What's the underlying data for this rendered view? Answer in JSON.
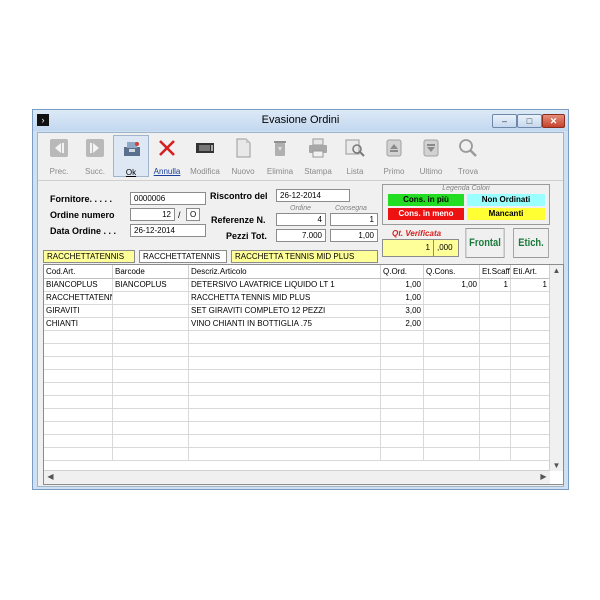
{
  "window": {
    "title": "Evasione Ordini",
    "minimize_glyph": "–",
    "maximize_glyph": "□",
    "close_glyph": "✕"
  },
  "toolbar": {
    "buttons": [
      {
        "label": "Prec.",
        "icon": "first-record-icon",
        "enabled": false
      },
      {
        "label": "Succ.",
        "icon": "next-record-icon",
        "enabled": false
      },
      {
        "label": "Ok",
        "icon": "ok-cash-register-icon",
        "enabled": true
      },
      {
        "label": "Annulla",
        "icon": "cancel-x-icon",
        "enabled": true
      },
      {
        "label": "Modifica",
        "icon": "edit-film-icon",
        "enabled": false
      },
      {
        "label": "Nuovo",
        "icon": "new-document-icon",
        "enabled": false
      },
      {
        "label": "Elimina",
        "icon": "delete-recycle-icon",
        "enabled": false
      },
      {
        "label": "Stampa",
        "icon": "printer-icon",
        "enabled": false
      },
      {
        "label": "Lista",
        "icon": "list-search-icon",
        "enabled": false
      },
      {
        "label": "Primo",
        "icon": "first-icon",
        "enabled": false
      },
      {
        "label": "Ultimo",
        "icon": "last-icon",
        "enabled": false
      },
      {
        "label": "Trova",
        "icon": "magnifier-icon",
        "enabled": false
      }
    ]
  },
  "form": {
    "fornitore_label": "Fornitore. . . . .",
    "fornitore_value": "0000006",
    "ordine_label": "Ordine numero",
    "ordine_value": "12",
    "ordine_sep": "/",
    "ordine_suffix": "O",
    "data_label": "Data Ordine . . .",
    "data_value": "26-12-2014",
    "riscontro_label": "Riscontro del",
    "riscontro_value": "26-12-2014",
    "ordine_col_label": "Ordine",
    "consegna_col_label": "Consegna",
    "referenze_label": "Referenze N.",
    "referenze_ordine": "4",
    "referenze_consegna": "1",
    "pezzi_label": "Pezzi Tot.",
    "pezzi_ordine": "7.000",
    "pezzi_consegna": "1,00",
    "search_code": "RACCHETTATENNIS",
    "search_barcode": "RACCHETTATENNIS",
    "search_desc": "RACCHETTA TENNIS MID PLUS",
    "verificata_label": "Qt. Verificata",
    "verificata_qty": "1",
    "verificata_dec": ",000",
    "frontal_label": "Frontal",
    "etich_label": "Etich."
  },
  "legend": {
    "title": "Legenda Colori",
    "items": [
      {
        "label": "Cons. in più",
        "bg": "#22dd22",
        "fg": "#000000"
      },
      {
        "label": "Non Ordinati",
        "bg": "#99ffff",
        "fg": "#000000"
      },
      {
        "label": "Cons. in meno",
        "bg": "#ee1111",
        "fg": "#ffffff"
      },
      {
        "label": "Mancanti",
        "bg": "#ffff33",
        "fg": "#000000"
      }
    ]
  },
  "grid": {
    "columns": [
      "Cod.Art.",
      "Barcode",
      "Descriz.Articolo",
      "Q.Ord.",
      "Q.Cons.",
      "Et.Scaff",
      "Eti.Art."
    ],
    "rows": [
      [
        "BIANCOPLUS",
        "BIANCOPLUS",
        "DETERSIVO LAVATRICE LIQUIDO LT 1",
        "1,00",
        "1,00",
        "1",
        "1"
      ],
      [
        "RACCHETTATENNIS",
        "",
        "RACCHETTA TENNIS MID PLUS",
        "1,00",
        "",
        "",
        ""
      ],
      [
        "GIRAVITI",
        "",
        "SET GIRAVITI COMPLETO 12 PEZZI",
        "3,00",
        "",
        "",
        ""
      ],
      [
        "CHIANTI",
        "",
        "VINO CHIANTI IN BOTTIGLIA .75",
        "2,00",
        "",
        "",
        ""
      ]
    ],
    "empty_rows": 10
  }
}
